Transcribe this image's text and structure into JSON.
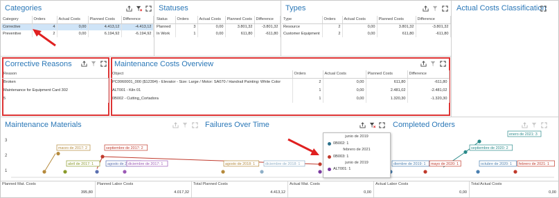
{
  "toolbar_icons": [
    "export-icon",
    "filter-icon",
    "fullscreen-icon"
  ],
  "categories": {
    "title": "Categories",
    "columns": [
      "Category",
      "Orders",
      "Actual Costs",
      "Planned Costs",
      "Difference"
    ],
    "rows": [
      [
        "Corrective",
        "4",
        "0,00",
        "4.413,12",
        "-4.413,12"
      ],
      [
        "Preventive",
        "2",
        "0,00",
        "6.194,92",
        "-6.194,92"
      ]
    ]
  },
  "statuses": {
    "title": "Statuses",
    "columns": [
      "Status",
      "Orders",
      "Actual Costs",
      "Planned Costs",
      "Difference"
    ],
    "rows": [
      [
        "Planned",
        "3",
        "0,00",
        "3.801,32",
        "-3.801,32"
      ],
      [
        "In Work",
        "1",
        "0,00",
        "611,80",
        "-611,80"
      ]
    ]
  },
  "types": {
    "title": "Types",
    "columns": [
      "Type",
      "Orders",
      "Actual Costs",
      "Planned Costs",
      "Difference"
    ],
    "rows": [
      [
        "Resource",
        "2",
        "0,00",
        "3.801,32",
        "-3.801,32"
      ],
      [
        "Customer Equipment",
        "2",
        "0,00",
        "611,80",
        "-611,80"
      ]
    ]
  },
  "actual_costs_classification": {
    "title": "Actual Costs Classification"
  },
  "corrective_reasons": {
    "title": "Corrective Reasons",
    "columns": [
      "Reason"
    ],
    "rows": [
      [
        "Broken"
      ],
      [
        "Maintenance for Equipment Card 302"
      ],
      [
        "5"
      ]
    ]
  },
  "maintenance_costs_overview": {
    "title": "Maintenance Costs Overview",
    "columns": [
      "Object",
      "Orders",
      "Actual Costs",
      "Planned Costs",
      "Difference"
    ],
    "rows": [
      [
        "PC0060001_000 ($12394) - Elevator - Size: Large / Motor: SA070 / Handrail Painting: White Color",
        "2",
        "0,00",
        "611,80",
        "-611,80"
      ],
      [
        "ALT001 - Kiln 01",
        "1",
        "0,00",
        "2.481,02",
        "-2.481,02"
      ],
      [
        "0B002 - Cutting_Cortadora",
        "1",
        "0,00",
        "1.320,30",
        "-1.320,30"
      ]
    ]
  },
  "maintenance_materials": {
    "title": "Maintenance Materials"
  },
  "failures_over_time": {
    "title": "Failures Over Time"
  },
  "completed_orders": {
    "title": "Completed Orders"
  },
  "chart_data": {
    "type": "line",
    "ylim": [
      1,
      3
    ],
    "yticks": [
      "1",
      "2",
      "3"
    ],
    "labels": [
      {
        "text": "marzo de 2017: 2",
        "color": "#b58a3c"
      },
      {
        "text": "septiembre de 2017: 2",
        "color": "#c0392b"
      },
      {
        "text": "abril de 2017: 1",
        "color": "#8a9a2a"
      },
      {
        "text": "agosto de 2017: 1",
        "color": "#5a6fb0"
      },
      {
        "text": "diciembre de 2017: 1",
        "color": "#9b59b6"
      },
      {
        "text": "agosto de 2018: 1",
        "color": "#b58a3c"
      },
      {
        "text": "diciembre de 2018: 1",
        "color": "#8fb0c8"
      },
      {
        "text": "enero de 2021: 3",
        "color": "#2a8a8a"
      },
      {
        "text": "septiembre de 2020: 2",
        "color": "#2a8a8a"
      },
      {
        "text": "diembre de 2019: 1",
        "color": "#4a7fb0"
      },
      {
        "text": "mayo de 2020: 1",
        "color": "#c0392b"
      },
      {
        "text": "octubre de 2020: 1",
        "color": "#4a7fb0"
      },
      {
        "text": "febrero de 2021: 1",
        "color": "#c0392b"
      }
    ]
  },
  "tooltip": {
    "entries": [
      {
        "header": "junio de 2019",
        "label": "0B002: 1",
        "color": "#2a6f8a"
      },
      {
        "header": "febrero de 2021",
        "label": "0B003: 1",
        "color": "#c0392b"
      },
      {
        "header": "junio de 2019",
        "label": "ALT001: 1",
        "color": "#7a3aa0"
      }
    ]
  },
  "footer": [
    {
      "label": "Planned Mat. Costs",
      "value": "395,80"
    },
    {
      "label": "Planned Labor Costs",
      "value": "4.017,32"
    },
    {
      "label": "Total Planned Costs",
      "value": "4.413,12"
    },
    {
      "label": "Actual Mat. Costs",
      "value": "0,00"
    },
    {
      "label": "Actual Labor Costs",
      "value": "0,00"
    },
    {
      "label": "Total Actual Costs",
      "value": "0,00"
    }
  ]
}
